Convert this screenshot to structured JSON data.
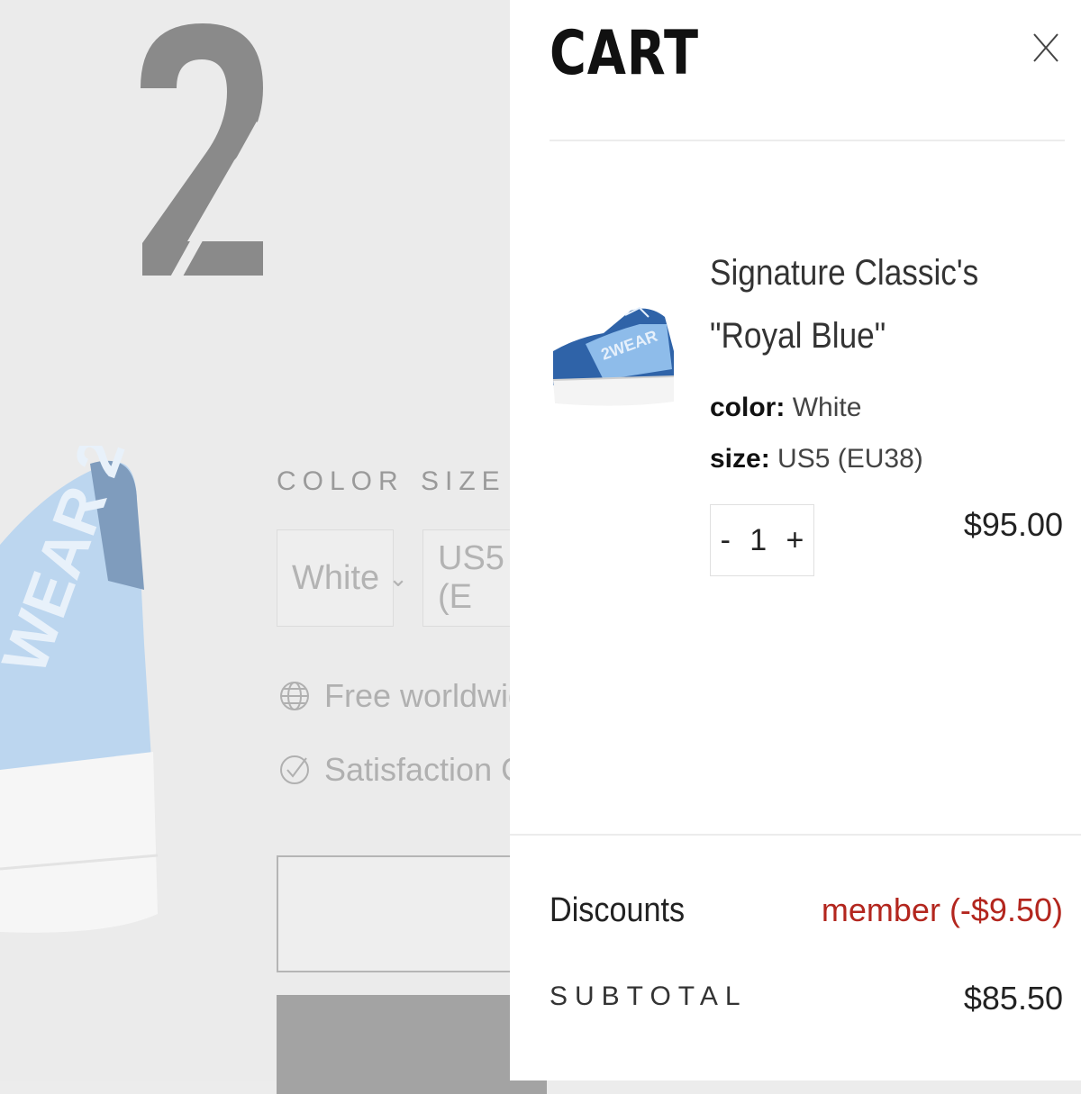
{
  "background": {
    "logo_icon": "two-wear-logo",
    "color_label": "COLOR",
    "size_label": "SIZE",
    "color_value": "White",
    "size_value": "US5 (E",
    "shipping_text": "Free worldwide s",
    "guarantee_text": "Satisfaction Guar"
  },
  "cart": {
    "title": "CART",
    "close_icon": "close-icon",
    "item": {
      "name": "Signature Classic's \"Royal Blue\"",
      "color_label": "color:",
      "color_value": "White",
      "size_label": "size:",
      "size_value": "US5 (EU38)",
      "quantity": "1",
      "decrement": "-",
      "increment": "+",
      "price": "$95.00"
    },
    "discounts_label": "Discounts",
    "discounts_value": "member (-$9.50)",
    "subtotal_label": "SUBTOTAL",
    "subtotal_value": "$85.50"
  },
  "colors": {
    "overlay": "#ebebeb",
    "discount_red": "#b3261e",
    "shoe_blue": "#2f63a8"
  }
}
